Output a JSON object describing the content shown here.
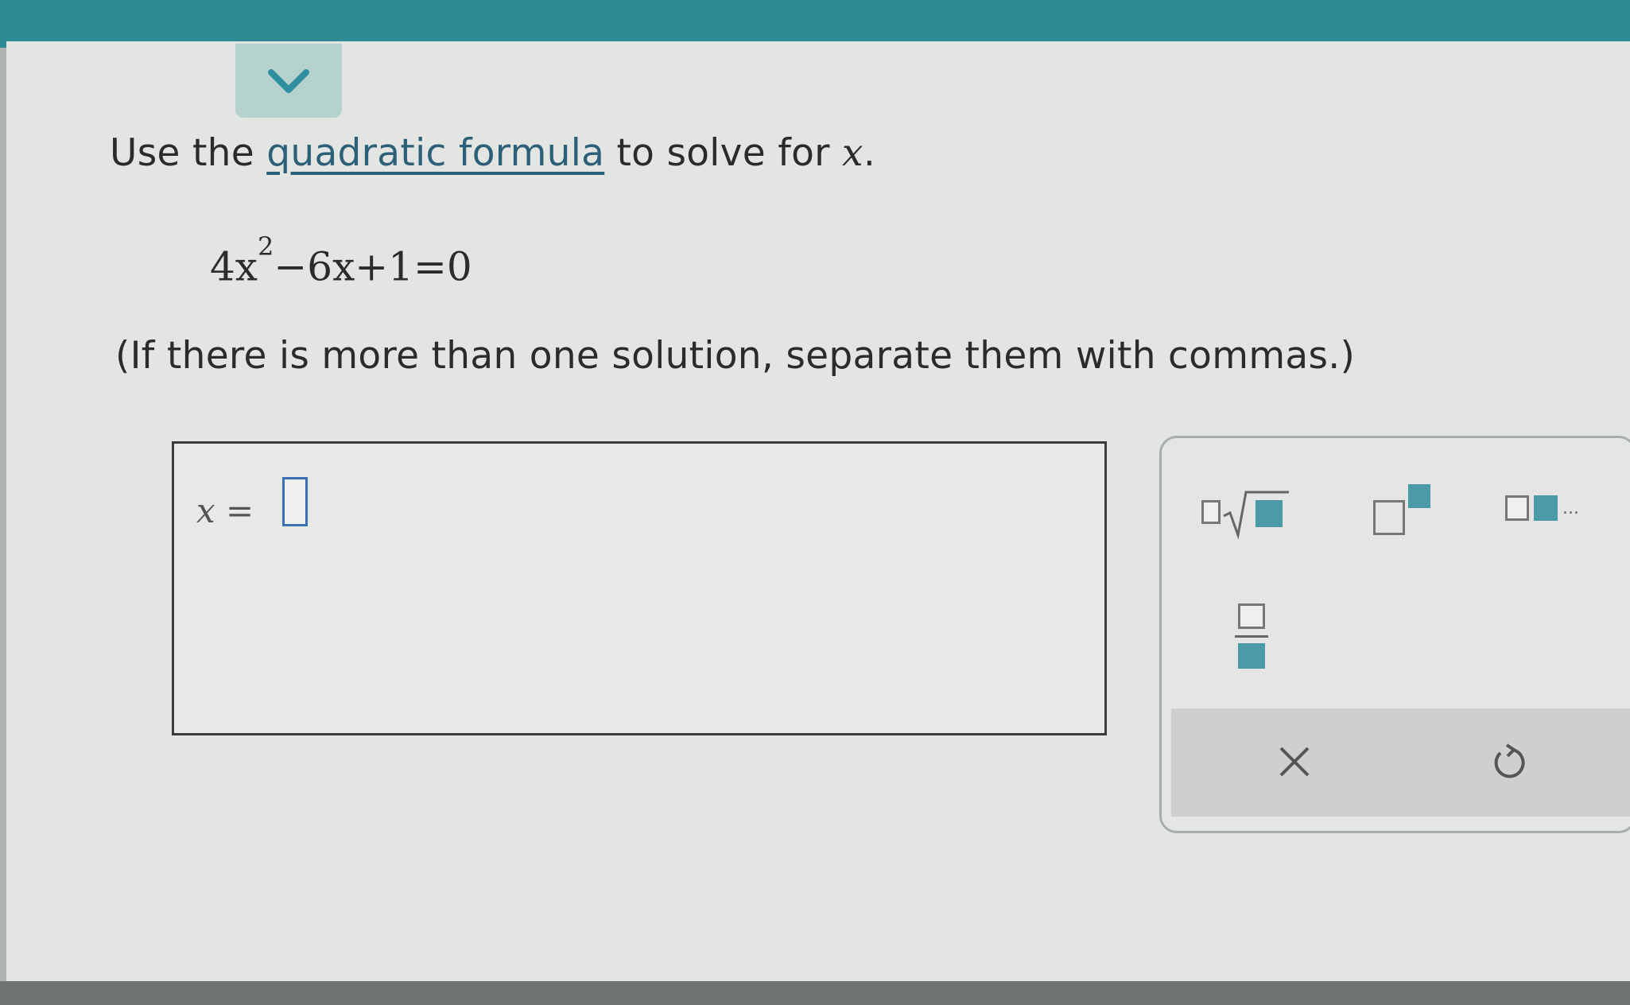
{
  "prompt": {
    "before": "Use the ",
    "link": "quadratic formula",
    "after": " to solve for ",
    "variable": "x",
    "end": "."
  },
  "equation": {
    "coef": "4x",
    "exponent": "2",
    "rest": "−6x+1=0"
  },
  "hint": "(If there is more than one solution, separate them with commas.)",
  "answer": {
    "variable": "x",
    "equals": "=",
    "value": ""
  },
  "palette": {
    "tools": [
      "root-tool",
      "exponent-tool",
      "list-tool",
      "fraction-tool"
    ],
    "list_ellipsis": "...",
    "clear_symbol": "×",
    "undo_symbol": "↺"
  },
  "colors": {
    "header": "#2e8b93",
    "link": "#2c5f78",
    "input_border": "#3b6fb0",
    "tool_accent": "#4a9aa8"
  }
}
